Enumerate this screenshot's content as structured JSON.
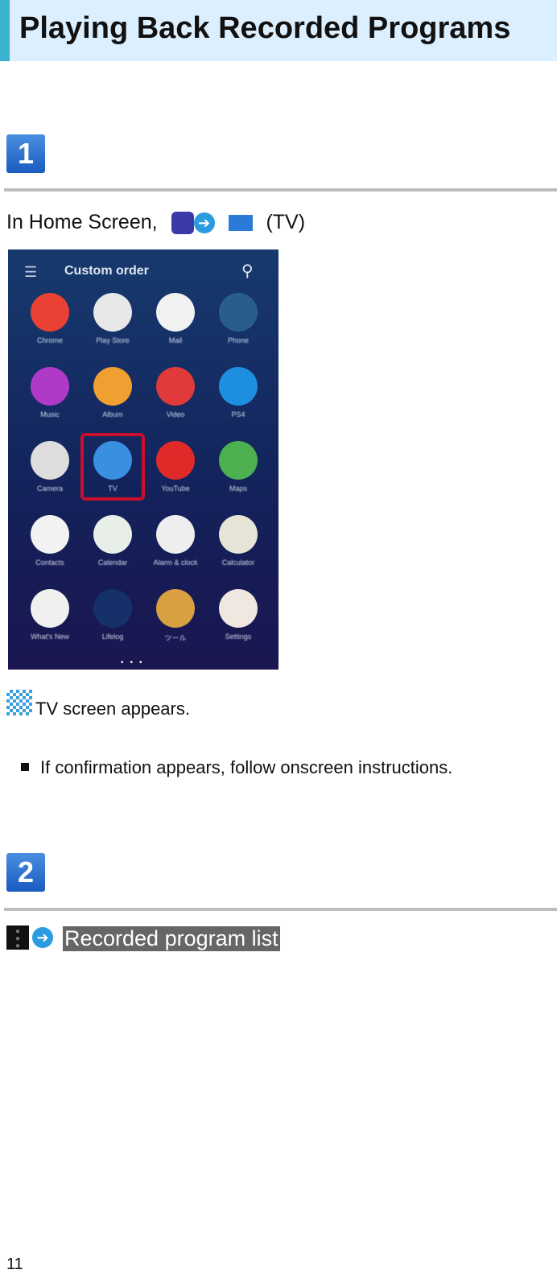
{
  "title": "Playing Back Recorded Programs",
  "step1": {
    "number": "1",
    "instruction_prefix": "In Home Screen,",
    "instruction_suffix": "(TV)",
    "result": "TV screen appears.",
    "note": "If confirmation appears, follow onscreen instructions."
  },
  "phone": {
    "header": "Custom order",
    "apps": [
      {
        "label": "Chrome",
        "color": "#e94235"
      },
      {
        "label": "Play Store",
        "color": "#e8e8e8"
      },
      {
        "label": "Mail",
        "color": "#f1f1f1"
      },
      {
        "label": "Phone",
        "color": "#2a5e8a"
      },
      {
        "label": "Music",
        "color": "#b03ac8"
      },
      {
        "label": "Album",
        "color": "#f0a030"
      },
      {
        "label": "Video",
        "color": "#e03a3a"
      },
      {
        "label": "PS4",
        "color": "#1e8fe0"
      },
      {
        "label": "Camera",
        "color": "#dddddd"
      },
      {
        "label": "TV",
        "color": "#3a8fe0"
      },
      {
        "label": "YouTube",
        "color": "#e02a2a"
      },
      {
        "label": "Maps",
        "color": "#4caf50"
      },
      {
        "label": "Contacts",
        "color": "#f2f2f2"
      },
      {
        "label": "Calendar",
        "color": "#e8efe8"
      },
      {
        "label": "Alarm & clock",
        "color": "#eeeeee"
      },
      {
        "label": "Calculator",
        "color": "#e6e4d6"
      },
      {
        "label": "What's New",
        "color": "#f0f0f0"
      },
      {
        "label": "Lifelog",
        "color": "#16306a"
      },
      {
        "label": "ツール",
        "color": "#d8a040"
      },
      {
        "label": "Settings",
        "color": "#f0e8e0"
      }
    ]
  },
  "step2": {
    "number": "2",
    "menu_label": "Recorded program list"
  },
  "page_number": "11"
}
